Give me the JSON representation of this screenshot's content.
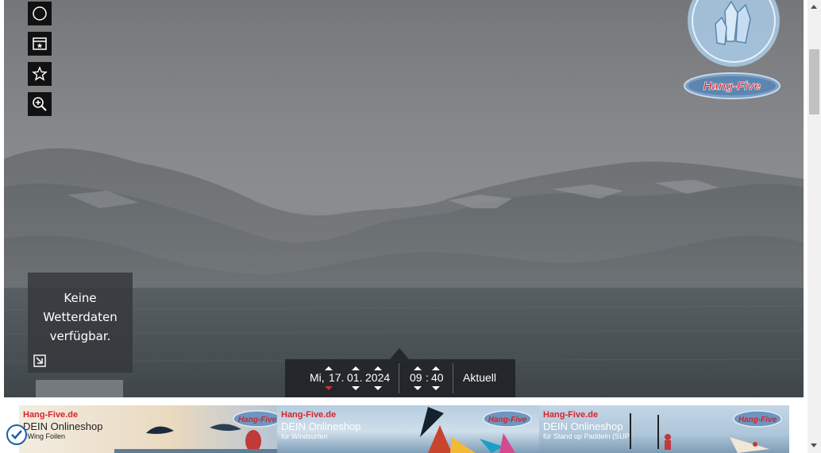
{
  "webcam": {
    "weather_text_1": "Keine",
    "weather_text_2": "Wetterdaten",
    "weather_text_3": "verfügbar.",
    "logo_text": "Hang-Five"
  },
  "side_tools": [
    {
      "icon": "moon-icon"
    },
    {
      "icon": "gallery-icon"
    },
    {
      "icon": "star-icon"
    },
    {
      "icon": "zoom-in-icon"
    }
  ],
  "timebar": {
    "weekday": "Mi,",
    "day": "17.",
    "month": "01.",
    "year": "2024",
    "hour": "09",
    "colon": ":",
    "minute": "40",
    "current_label": "Aktuell"
  },
  "banner": {
    "panels": [
      {
        "brand": "Hang-Five.de",
        "title": "DEIN Onlineshop",
        "subtitle": "r Wing Foilen"
      },
      {
        "brand": "Hang-Five.de",
        "title": "DEIN Onlineshop",
        "subtitle": "für Windsurfen"
      },
      {
        "brand": "Hang-Five.de",
        "title": "DEIN Onlineshop",
        "subtitle": "für Stand up Paddeln (SUP)"
      }
    ],
    "logo_text": "Hang-Five"
  },
  "colors": {
    "accent_red": "#d8232a",
    "timebar_bg": "#1e2124",
    "badge_blue": "#1c5fa8"
  }
}
